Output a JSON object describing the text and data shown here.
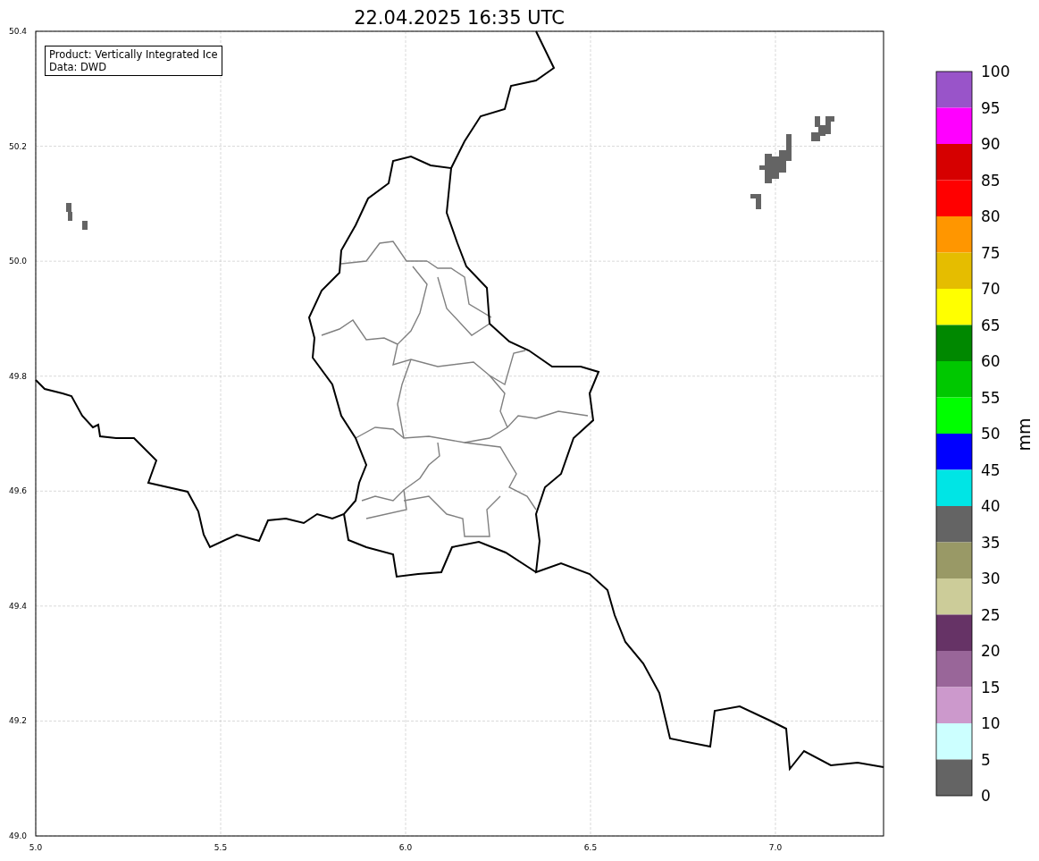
{
  "title": "22.04.2025 16:35 UTC",
  "info_box": [
    "Product: Vertically Integrated Ice",
    "Data: DWD"
  ],
  "x_ticks": [
    "5.0",
    "5.5",
    "6.0",
    "6.5",
    "7.0"
  ],
  "y_ticks": [
    "50.4",
    "50.2",
    "50.0",
    "49.8",
    "49.6",
    "49.4",
    "49.2",
    "49.0"
  ],
  "colorbar": {
    "unit": "mm",
    "ticks": [
      "100",
      "95",
      "90",
      "85",
      "80",
      "75",
      "70",
      "65",
      "60",
      "55",
      "50",
      "45",
      "40",
      "35",
      "30",
      "25",
      "20",
      "15",
      "10",
      "5",
      "0"
    ],
    "bands": [
      {
        "color": "#9954c9"
      },
      {
        "color": "#ff00ff"
      },
      {
        "color": "#d60000"
      },
      {
        "color": "#ff0000"
      },
      {
        "color": "#ff9600"
      },
      {
        "color": "#e5bd00"
      },
      {
        "color": "#ffff00"
      },
      {
        "color": "#008800"
      },
      {
        "color": "#00c800"
      },
      {
        "color": "#00ff00"
      },
      {
        "color": "#0000ff"
      },
      {
        "color": "#00e5e5"
      },
      {
        "color": "#646464"
      },
      {
        "color": "#999966"
      },
      {
        "color": "#cccc99"
      },
      {
        "color": "#663366"
      },
      {
        "color": "#996699"
      },
      {
        "color": "#cc99cc"
      },
      {
        "color": "#ccffff"
      },
      {
        "color": "#646464"
      }
    ]
  }
}
